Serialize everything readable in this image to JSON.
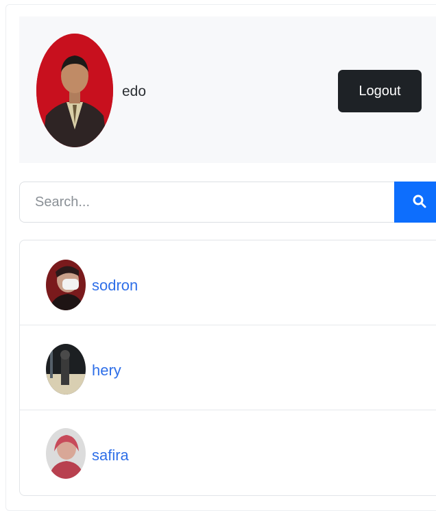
{
  "profile": {
    "name": "edo",
    "logout_label": "Logout"
  },
  "search": {
    "placeholder": "Search...",
    "button_icon": "search-icon"
  },
  "users": [
    {
      "name": "sodron"
    },
    {
      "name": "hery"
    },
    {
      "name": "safira"
    }
  ],
  "colors": {
    "accent": "#0d6efd",
    "link": "#2f6fe8",
    "logout_bg": "#1e2226",
    "avatar_bg": "#c8101e"
  }
}
